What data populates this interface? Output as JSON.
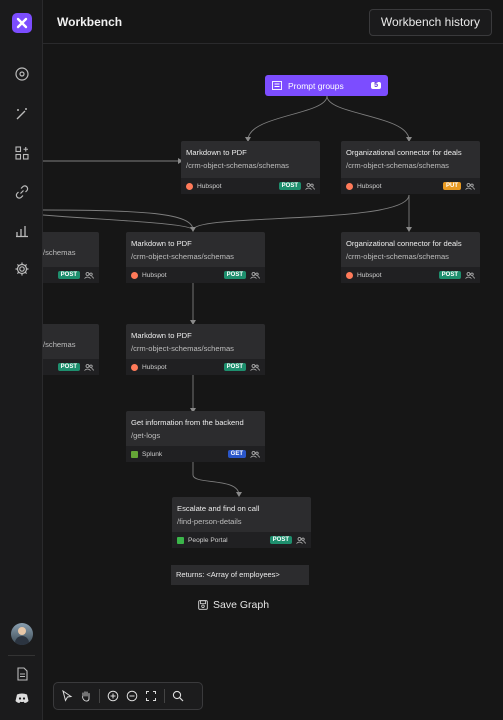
{
  "app": {
    "title": "Workbench",
    "history_button": "Workbench history"
  },
  "sidebar": {
    "icons": [
      "dashboard-settings-icon",
      "magic-wand-icon",
      "apps-add-icon",
      "link-icon",
      "bar-chart-icon",
      "gear-icon"
    ],
    "bottom_icons": [
      "document-icon",
      "discord-icon"
    ]
  },
  "prompt_groups": {
    "label": "Prompt groups",
    "count": "5"
  },
  "nodes": {
    "n1": {
      "name": "Markdown to PDF",
      "path": "/crm-object-schemas/schemas",
      "service": "Hubspot",
      "method": "POST"
    },
    "n2": {
      "name": "Organizational connector for deals",
      "path": "/crm-object-schemas/schemas",
      "service": "Hubspot",
      "method": "PUT"
    },
    "n3": {
      "name": "",
      "path": "/schemas",
      "service": "",
      "method": "POST"
    },
    "n4": {
      "name": "Markdown to PDF",
      "path": "/crm-object-schemas/schemas",
      "service": "Hubspot",
      "method": "POST"
    },
    "n5": {
      "name": "Organizational connector for deals",
      "path": "/crm-object-schemas/schemas",
      "service": "Hubspot",
      "method": "POST"
    },
    "n6": {
      "name": "",
      "path": "/schemas",
      "service": "",
      "method": "POST"
    },
    "n7": {
      "name": "Markdown to PDF",
      "path": "/crm-object-schemas/schemas",
      "service": "Hubspot",
      "method": "POST"
    },
    "n8": {
      "name": "Get information from the backend",
      "path": "/get-logs",
      "service": "Splunk",
      "method": "GET"
    },
    "n9": {
      "name": "Escalate and find on call",
      "path": "/find-person-details",
      "service": "People Portal",
      "method": "POST"
    }
  },
  "returns": "Returns: <Array of employees>",
  "save_graph": "Save Graph",
  "colors": {
    "accent": "#7c4dff",
    "post": "#1e8f6e",
    "put": "#e89a22",
    "get": "#2a56c9",
    "hubspot": "#ff7a59",
    "splunk": "#65a637",
    "people_portal": "#3bb54a"
  },
  "toolbar": [
    "pointer-icon",
    "hand-icon",
    "zoom-in-icon",
    "zoom-out-icon",
    "fit-view-icon",
    "search-icon"
  ]
}
